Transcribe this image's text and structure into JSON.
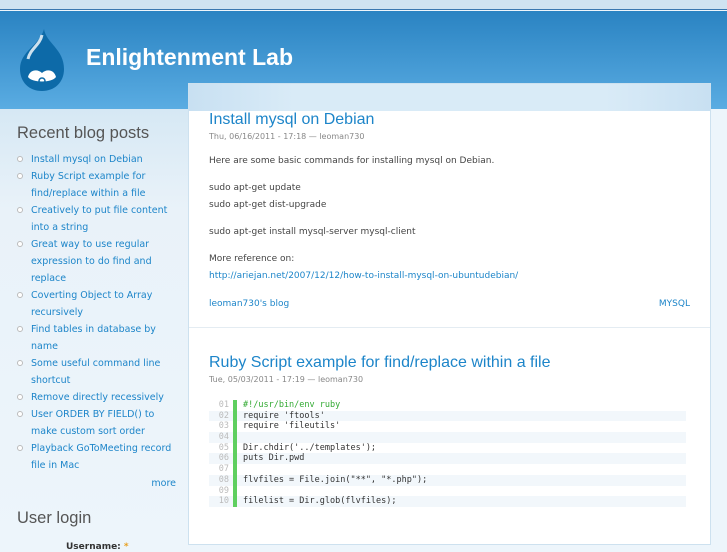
{
  "site": {
    "name": "Enlightenment Lab"
  },
  "sidebar": {
    "recent_title": "Recent blog posts",
    "posts": [
      "Install mysql on Debian",
      "Ruby Script example for find/replace within a file",
      "Creatively to put file content into a string",
      "Great way to use regular expression to do find and replace",
      "Coverting Object to Array recursively",
      "Find tables in database by name",
      "Some useful command line shortcut",
      "Remove directly recessively",
      "User ORDER BY FIELD() to make custom sort order",
      "Playback GoToMeeting record file in Mac"
    ],
    "more": "more",
    "login_title": "User login",
    "username_label": "Username:",
    "required": "*"
  },
  "nodes": [
    {
      "title": "Install mysql on Debian",
      "meta": "Thu, 06/16/2011 - 17:18 — leoman730",
      "paragraphs": [
        "Here are some basic commands for installing mysql on Debian.",
        "sudo apt-get update",
        "sudo apt-get dist-upgrade",
        "sudo apt-get install mysql-server mysql-client",
        "More reference on:"
      ],
      "link": "http://ariejan.net/2007/12/12/how-to-install-mysql-on-ubuntudebian/",
      "blog_link": "leoman730's blog",
      "tag": "MYSQL"
    },
    {
      "title": "Ruby Script example for find/replace within a file",
      "meta": "Tue, 05/03/2011 - 17:19 — leoman730",
      "code": [
        {
          "n": "01",
          "t": "#!/usr/bin/env ruby"
        },
        {
          "n": "02",
          "t": "require 'ftools'"
        },
        {
          "n": "03",
          "t": "require 'fileutils'"
        },
        {
          "n": "04",
          "t": ""
        },
        {
          "n": "05",
          "t": "Dir.chdir('../templates');"
        },
        {
          "n": "06",
          "t": "puts Dir.pwd"
        },
        {
          "n": "07",
          "t": ""
        },
        {
          "n": "08",
          "t": "flvfiles = File.join(\"**\", \"*.php\");"
        },
        {
          "n": "09",
          "t": ""
        },
        {
          "n": "10",
          "t": "filelist = Dir.glob(flvfiles);"
        }
      ]
    }
  ]
}
